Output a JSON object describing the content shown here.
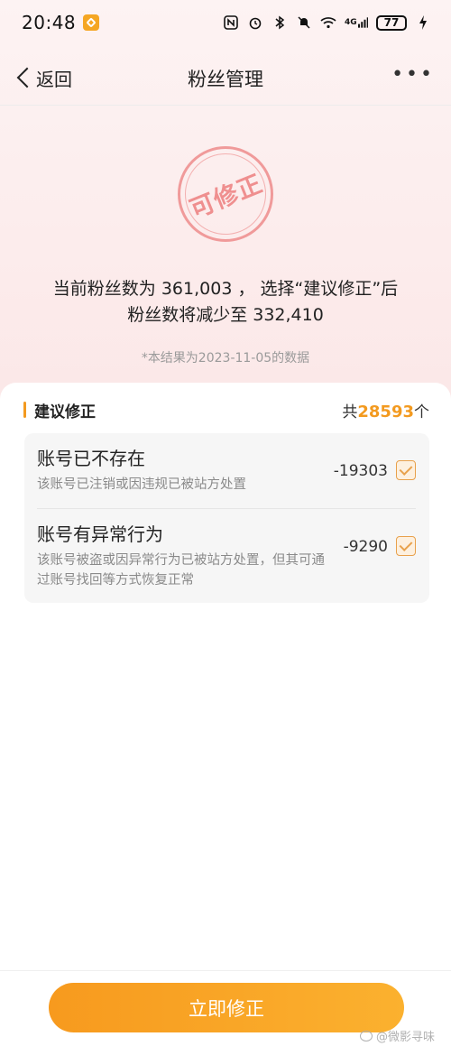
{
  "status_bar": {
    "time": "20:48",
    "network": "4G",
    "battery": "77"
  },
  "nav": {
    "back_label": "返回",
    "title": "粉丝管理",
    "more_label": "•••"
  },
  "hero": {
    "stamp_text": "可修正",
    "summary_line1": "当前粉丝数为 361,003 ， 选择“建议修正”后",
    "summary_line2": "粉丝数将减少至 332,410",
    "data_note": "*本结果为2023-11-05的数据"
  },
  "section": {
    "title": "建议修正",
    "total_prefix": "共",
    "total_value": "28593",
    "total_suffix": "个"
  },
  "items": [
    {
      "title": "账号已不存在",
      "description": "该账号已注销或因违规已被站方处置",
      "count": "-19303",
      "checked": true
    },
    {
      "title": "账号有异常行为",
      "description": "该账号被盗或因异常行为已被站方处置，但其可通过账号找回等方式恢复正常",
      "count": "-9290",
      "checked": true
    }
  ],
  "action": {
    "button_label": "立即修正"
  },
  "watermark": "@微影寻味",
  "colors": {
    "accent": "#f39a1f",
    "stamp": "#ef8f8f",
    "hero_bg": "#fbe7e7"
  }
}
